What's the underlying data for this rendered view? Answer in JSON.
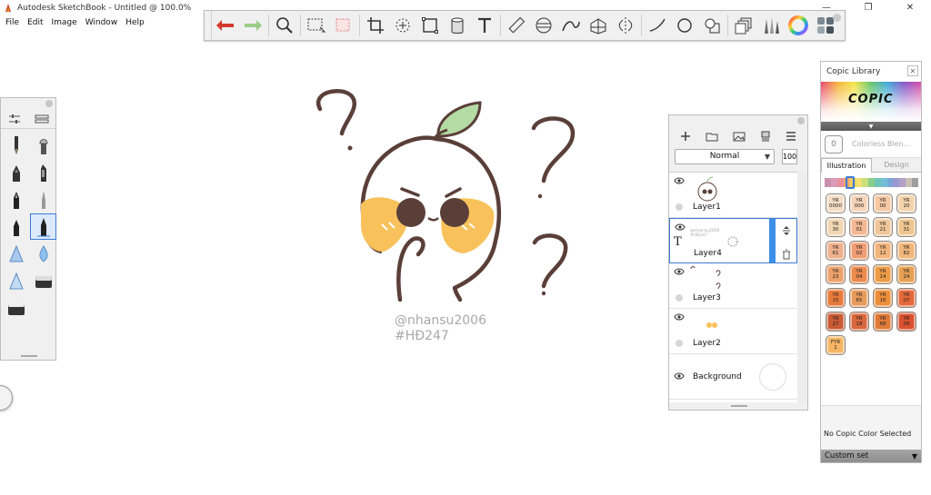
{
  "window": {
    "title": "Autodesk SketchBook - Untitled @ 100.0%",
    "controls": [
      "—",
      "❐",
      "✕"
    ]
  },
  "menu": [
    "File",
    "Edit",
    "Image",
    "Window",
    "Help"
  ],
  "toolbar": {
    "tools": [
      "undo-icon",
      "redo-icon",
      "zoom-icon",
      "rect-select-icon",
      "lasso-icon",
      "crop-icon",
      "transform-icon",
      "distort-icon",
      "fill-icon",
      "text-icon",
      "ruler-icon",
      "ellipse-guide-icon",
      "french-curve-icon",
      "perspective-icon",
      "symmetry-icon",
      "stroke-line-icon",
      "circle-icon",
      "shape-icon",
      "layers-icon",
      "brushes-icon",
      "color-wheel-icon",
      "copic-icon"
    ]
  },
  "canvas": {
    "watermark_line1": "@nhansu2006",
    "watermark_line2": "#HĐ247"
  },
  "layers_panel": {
    "blend_mode": "Normal",
    "opacity": "100",
    "layers": [
      {
        "name": "Layer1",
        "selected": false
      },
      {
        "name": "Layer4",
        "selected": true,
        "thumb_text": "@nhansu2006\n#HĐ247"
      },
      {
        "name": "Layer3",
        "selected": false
      },
      {
        "name": "Layer2",
        "selected": false
      },
      {
        "name": "Background",
        "selected": false
      }
    ]
  },
  "copic_panel": {
    "title": "Copic Library",
    "logo": "COPIC",
    "blender_label": "Colorless Blen...",
    "blender_code": "0",
    "tabs": [
      "Illustration",
      "Design"
    ],
    "active_tab": "Illustration",
    "strip_colors": [
      "#c98fae",
      "#d99bb8",
      "#ea8fa0",
      "#f2a56a",
      "#f3c95f",
      "#f2e071",
      "#c9df7a",
      "#8ccf8c",
      "#6fc6b7",
      "#74bfd7",
      "#7aa6d8",
      "#9a9ad0",
      "#b5a0c8",
      "#c9c0b8",
      "#9e9e9e"
    ],
    "swatches": [
      {
        "code": "YR\n0000",
        "color": "#f6dcc5"
      },
      {
        "code": "YR\n000",
        "color": "#f6d3b8"
      },
      {
        "code": "YR\n00",
        "color": "#f5c7a3"
      },
      {
        "code": "YR\n20",
        "color": "#f4d3ab"
      },
      {
        "code": "YR\n30",
        "color": "#f1d6b2"
      },
      {
        "code": "YR\n01",
        "color": "#f3b893"
      },
      {
        "code": "YR\n21",
        "color": "#f0c79a"
      },
      {
        "code": "YR\n31",
        "color": "#efc690"
      },
      {
        "code": "YR\n61",
        "color": "#efb08d"
      },
      {
        "code": "YR\n02",
        "color": "#ef9d73"
      },
      {
        "code": "YR\n12",
        "color": "#f2b57d"
      },
      {
        "code": "YR\n82",
        "color": "#f1b67a"
      },
      {
        "code": "YR\n23",
        "color": "#eca16a"
      },
      {
        "code": "YR\n04",
        "color": "#ec8b4d"
      },
      {
        "code": "YR\n14",
        "color": "#ee9c46"
      },
      {
        "code": "YR\n24",
        "color": "#e6a154"
      },
      {
        "code": "YR\n15",
        "color": "#e77a3a"
      },
      {
        "code": "YR\n65",
        "color": "#e79b5a"
      },
      {
        "code": "YR\n16",
        "color": "#ed8e3a"
      },
      {
        "code": "YR\n07",
        "color": "#e4693a"
      },
      {
        "code": "YR\n27",
        "color": "#c95a34"
      },
      {
        "code": "YR\n18",
        "color": "#d9673d"
      },
      {
        "code": "YR\n68",
        "color": "#e07a38"
      },
      {
        "code": "YR\n09",
        "color": "#d9512f"
      },
      {
        "code": "FYR\n1",
        "color": "#f7b564"
      }
    ],
    "status": "No Copic Color Selected",
    "set_label": "Custom set"
  }
}
